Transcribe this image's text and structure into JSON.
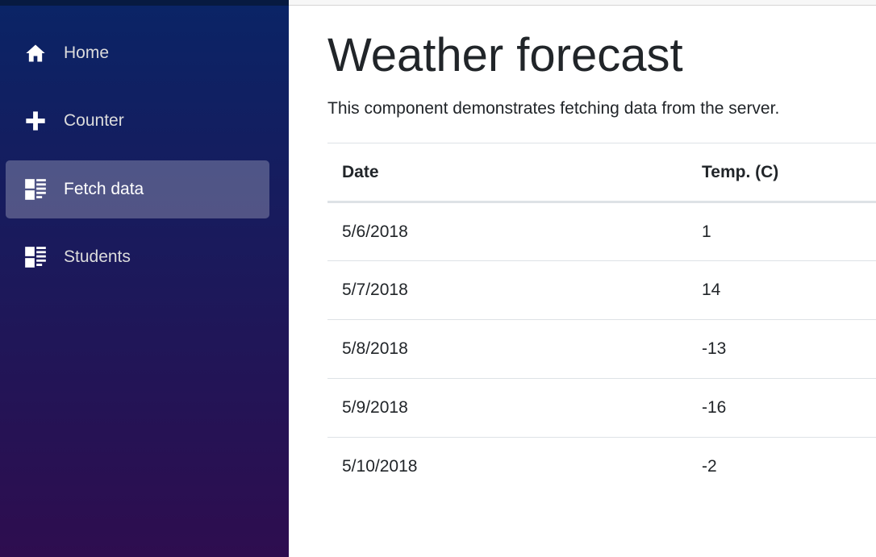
{
  "sidebar": {
    "items": [
      {
        "label": "Home",
        "icon": "home-icon",
        "active": false
      },
      {
        "label": "Counter",
        "icon": "plus-icon",
        "active": false
      },
      {
        "label": "Fetch data",
        "icon": "list-icon",
        "active": true
      },
      {
        "label": "Students",
        "icon": "list-icon",
        "active": false
      }
    ]
  },
  "main": {
    "title": "Weather forecast",
    "description": "This component demonstrates fetching data from the server.",
    "table": {
      "headers": [
        "Date",
        "Temp. (C)"
      ],
      "rows": [
        [
          "5/6/2018",
          "1"
        ],
        [
          "5/7/2018",
          "14"
        ],
        [
          "5/8/2018",
          "-13"
        ],
        [
          "5/9/2018",
          "-16"
        ],
        [
          "5/10/2018",
          "-2"
        ]
      ]
    }
  },
  "colors": {
    "sidebar_top": "#0a2466",
    "sidebar_bottom": "#2e0d4f",
    "active_item": "rgba(255,255,255,0.25)",
    "text": "#212529"
  }
}
